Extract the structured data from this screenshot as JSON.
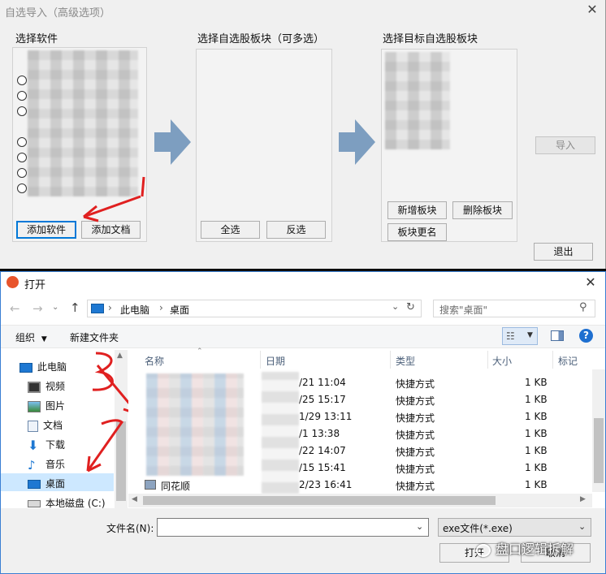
{
  "top_dialog": {
    "title": "自选导入（高级选项）",
    "close_icon": "close-icon",
    "select_software_label": "选择软件",
    "select_blocks_label": "选择自选股板块（可多选）",
    "select_target_label": "选择目标自选股板块",
    "add_software": "添加软件",
    "add_document": "添加文档",
    "select_all": "全选",
    "invert_select": "反选",
    "import": "导入",
    "new_block": "新增板块",
    "delete_block": "删除板块",
    "rename_block": "板块更名",
    "exit": "退出"
  },
  "open_dialog": {
    "title": "打开",
    "breadcrumb": [
      "此电脑",
      "桌面"
    ],
    "search_placeholder": "搜索\"桌面\"",
    "organize": "组织",
    "new_folder": "新建文件夹",
    "nav_items": [
      {
        "label": "此电脑",
        "icon": "computer-icon"
      },
      {
        "label": "视频",
        "icon": "video-folder-icon"
      },
      {
        "label": "图片",
        "icon": "pictures-folder-icon"
      },
      {
        "label": "文档",
        "icon": "documents-folder-icon"
      },
      {
        "label": "下载",
        "icon": "download-icon"
      },
      {
        "label": "音乐",
        "icon": "music-icon"
      },
      {
        "label": "桌面",
        "icon": "desktop-icon"
      },
      {
        "label": "本地磁盘 (C:)",
        "icon": "disk-icon"
      }
    ],
    "columns": [
      "名称",
      "日期",
      "类型",
      "大小",
      "标记"
    ],
    "files": [
      {
        "name": "",
        "date": "/21 11:04",
        "type": "快捷方式",
        "size": "1 KB"
      },
      {
        "name": "",
        "date": "/25 15:17",
        "type": "快捷方式",
        "size": "1 KB"
      },
      {
        "name": "",
        "date": "1/29 13:11",
        "type": "快捷方式",
        "size": "1 KB"
      },
      {
        "name": "",
        "date": "/1 13:38",
        "type": "快捷方式",
        "size": "1 KB"
      },
      {
        "name": "",
        "date": "/22 14:07",
        "type": "快捷方式",
        "size": "1 KB"
      },
      {
        "name": "",
        "date": "/15 15:41",
        "type": "快捷方式",
        "size": "1 KB"
      },
      {
        "name": "同花顺",
        "date": "2/23 16:41",
        "type": "快捷方式",
        "size": "1 KB"
      }
    ],
    "filename_label": "文件名(N):",
    "filename_value": "",
    "filetype": "exe文件(*.exe)",
    "open_button": "打开",
    "cancel_button": "取消",
    "watermark": "盘口逻辑拆解"
  }
}
